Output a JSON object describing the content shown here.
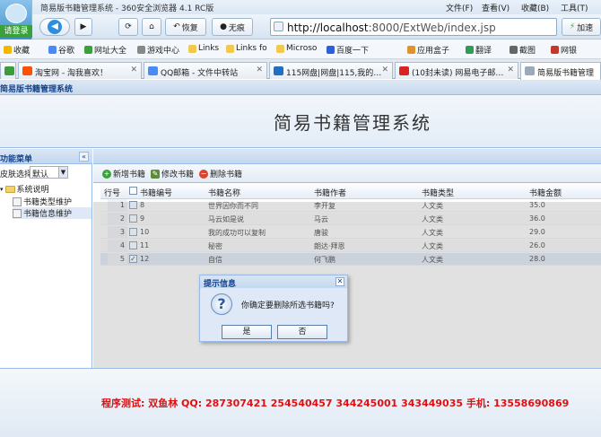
{
  "browser": {
    "window_title": "简易版书籍管理系统 - 360安全浏览器 4.1 RC版",
    "menu": [
      "文件(F)",
      "查看(V)",
      "收藏(B)",
      "工具(T)"
    ],
    "login_label": "请登录",
    "nav": {
      "restore_label": "恢复",
      "incognito_label": "无痕"
    },
    "address": {
      "host": "http://localhost",
      "rest": ":8000/ExtWeb/index.jsp"
    },
    "speed_label": "加速",
    "favorites": [
      "收藏",
      "谷歌",
      "网址大全",
      "游戏中心",
      "Links",
      "Links fo",
      "Microso",
      "百度一下",
      "应用盒子",
      "翻译",
      "截图",
      "网银"
    ],
    "tabs": [
      "淘宝网 - 淘我喜欢！",
      "QQ邮箱 - 文件中转站",
      "115网盘|网盘|115,我的…",
      "(10封未读) 网易电子邮…",
      "简易版书籍管理"
    ]
  },
  "app": {
    "tab_title": "简易版书籍管理系统",
    "big_title": "简易书籍管理系统",
    "left_panel": {
      "title": "功能菜单",
      "skin_label": "皮肤选择",
      "skin_value": "默认",
      "tree": {
        "root": "系统说明",
        "items": [
          "书籍类型维护",
          "书籍信息维护"
        ]
      }
    },
    "toolbar": {
      "add": "新增书籍",
      "edit": "修改书籍",
      "delete": "删除书籍"
    },
    "grid": {
      "columns": [
        "行号",
        "书籍编号",
        "书籍名称",
        "书籍作者",
        "书籍类型",
        "书籍金额"
      ],
      "rows": [
        {
          "n": "1",
          "id": "8",
          "name": "世界因你而不同",
          "author": "李开复",
          "type": "人文类",
          "price": "35.0",
          "checked": false
        },
        {
          "n": "2",
          "id": "9",
          "name": "马云如是说",
          "author": "马云",
          "type": "人文类",
          "price": "36.0",
          "checked": false
        },
        {
          "n": "3",
          "id": "10",
          "name": "我的成功可以复制",
          "author": "唐骏",
          "type": "人文类",
          "price": "29.0",
          "checked": false
        },
        {
          "n": "4",
          "id": "11",
          "name": "秘密",
          "author": "朗达·拜恩",
          "type": "人文类",
          "price": "26.0",
          "checked": false
        },
        {
          "n": "5",
          "id": "12",
          "name": "自信",
          "author": "何飞鹏",
          "type": "人文类",
          "price": "28.0",
          "checked": true
        }
      ]
    },
    "dialog": {
      "title": "提示信息",
      "message": "你确定要删除所选书籍吗?",
      "yes_label": "是",
      "no_label": "否"
    },
    "footer": "程序测试: 双鱼林      QQ: 287307421   254540457   344245001  343449035    手机: 13558690869"
  }
}
